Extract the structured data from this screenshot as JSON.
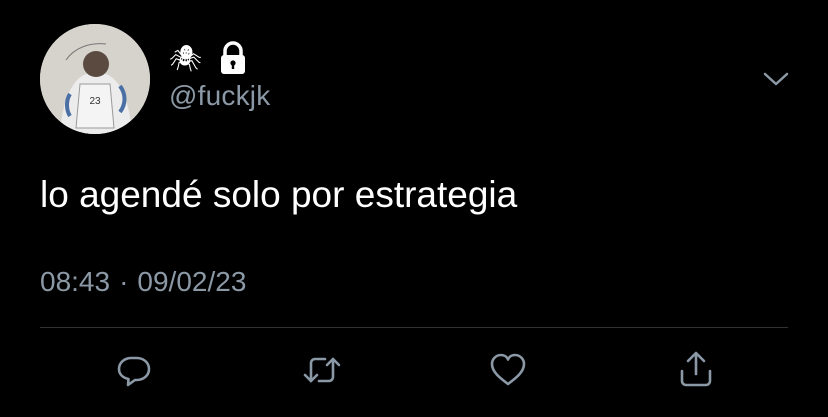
{
  "tweet": {
    "display_name": "🕷",
    "handle": "@fuckjk",
    "text": "lo agendé solo por estrategia",
    "time": "08:43",
    "separator": "·",
    "date": "09/02/23"
  },
  "icons": {
    "lock": "lock-icon",
    "more": "chevron-down-icon",
    "reply": "reply-icon",
    "retweet": "retweet-icon",
    "like": "heart-icon",
    "share": "share-icon"
  },
  "colors": {
    "background": "#000000",
    "primary_text": "#ffffff",
    "secondary_text": "#8b98a5",
    "divider": "#2f3336"
  }
}
